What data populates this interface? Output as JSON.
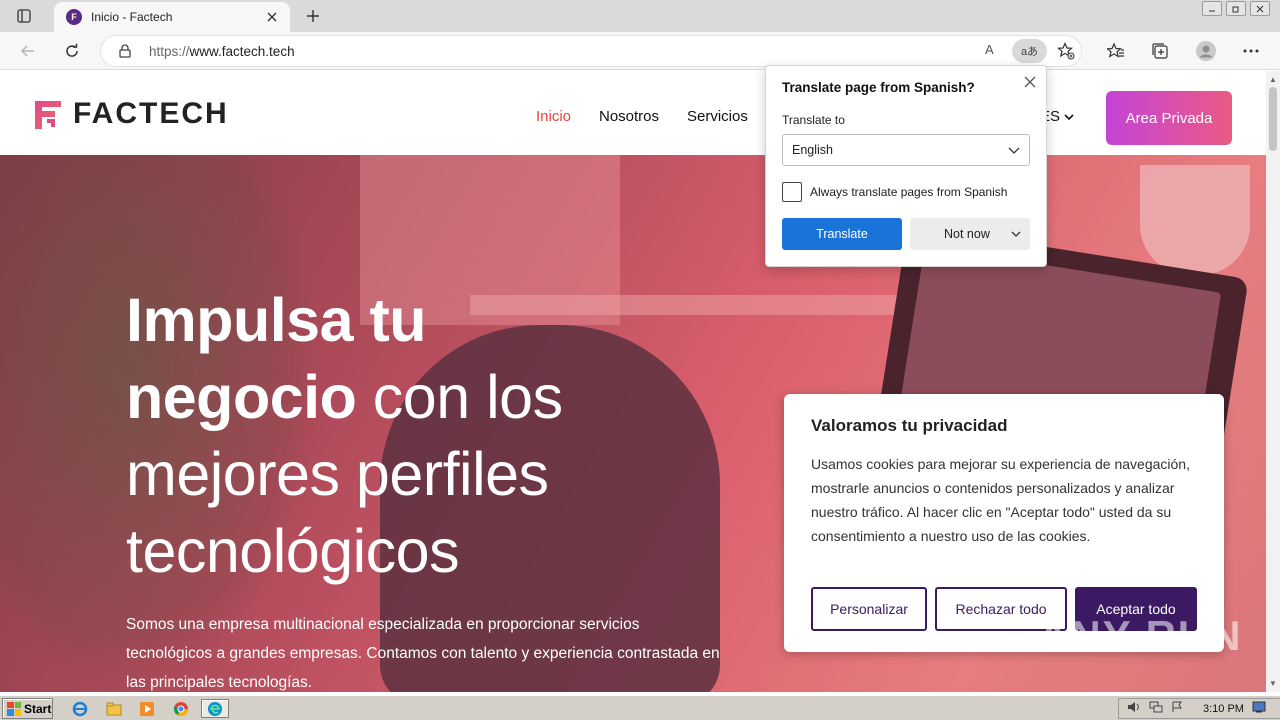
{
  "browser": {
    "tab_title": "Inicio - Factech",
    "url_scheme": "https://",
    "url_host": "www.factech.tech",
    "translate_badge": "aあ",
    "read_aloud": "A"
  },
  "site": {
    "brand": "FACTECH",
    "nav": [
      "Inicio",
      "Nosotros",
      "Servicios"
    ],
    "lang": "ES",
    "area_button": "Area Privada",
    "hero_title_bold1": "Impulsa tu",
    "hero_title_bold2": "negocio",
    "hero_title_rest": " con los mejores perfiles tecnológicos",
    "hero_sub": "Somos una empresa multinacional especializada en proporcionar servicios tecnológicos a grandes empresas. Contamos con talento y experiencia contrastada en las principales tecnologías."
  },
  "cookie": {
    "title": "Valoramos tu privacidad",
    "body": "Usamos cookies para mejorar su experiencia de navegación, mostrarle anuncios o contenidos personalizados y analizar nuestro tráfico. Al hacer clic en \"Aceptar todo\" usted da su consentimiento a nuestro uso de las cookies.",
    "btn_customize": "Personalizar",
    "btn_reject": "Rechazar todo",
    "btn_accept": "Aceptar todo"
  },
  "translate": {
    "title": "Translate page from Spanish?",
    "label": "Translate to",
    "selected_language": "English",
    "always_label": "Always translate pages from Spanish",
    "translate_button": "Translate",
    "not_now_button": "Not now"
  },
  "watermark": "ANY RUN",
  "taskbar": {
    "start": "Start",
    "clock": "3:10 PM"
  },
  "colors": {
    "accent_red": "#e8453c",
    "brand_purple": "#3b1a63",
    "translate_blue": "#1a73d9"
  }
}
